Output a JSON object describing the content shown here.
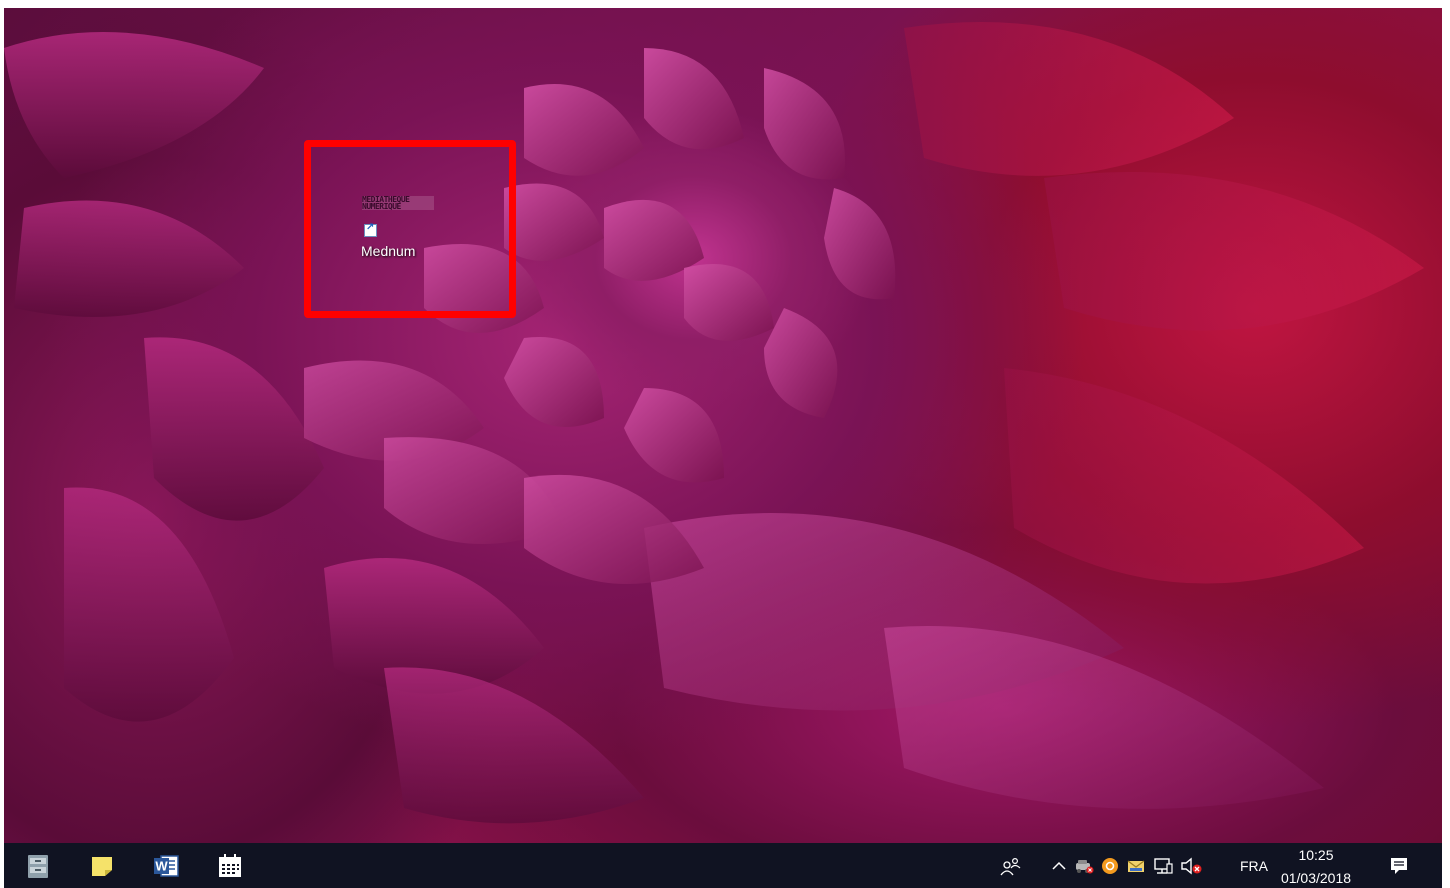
{
  "desktop": {
    "icons": [
      {
        "logo_line1": "MEDIATHEQUE",
        "logo_line2": "NUMERIQUE",
        "label": "Mednum"
      }
    ],
    "highlight_color": "#ff0000"
  },
  "taskbar": {
    "background": "#101322",
    "pinned": [
      {
        "name": "file-cabinet-icon"
      },
      {
        "name": "sticky-notes-icon"
      },
      {
        "name": "word-icon",
        "letter": "W"
      },
      {
        "name": "calendar-icon"
      }
    ],
    "tray": {
      "people_icon": "people-icon",
      "overflow_icon": "chevron-up-icon",
      "language": "FRA",
      "time": "10:25",
      "date": "01/03/2018"
    }
  }
}
